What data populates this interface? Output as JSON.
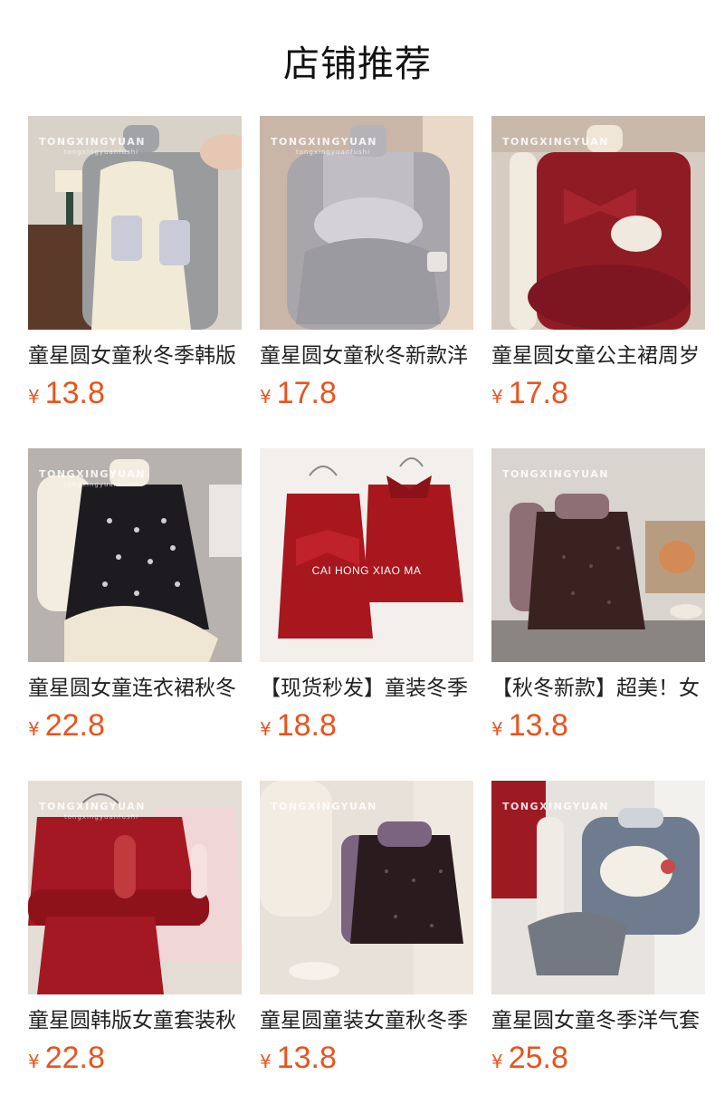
{
  "page": {
    "title": "店铺推荐"
  },
  "products": [
    {
      "name": "童星圆女童秋冬季韩版",
      "currency": "¥",
      "price": "13.8",
      "watermark": "TONGXINGYUAN",
      "watermark_sub": "tongxingyuanfushi"
    },
    {
      "name": "童星圆女童秋冬新款洋",
      "currency": "¥",
      "price": "17.8",
      "watermark": "TONGXINGYUAN",
      "watermark_sub": "tongxingyuanfushi"
    },
    {
      "name": "童星圆女童公主裙周岁",
      "currency": "¥",
      "price": "17.8",
      "watermark": "TONGXINGYUAN",
      "watermark_sub": ""
    },
    {
      "name": "童星圆女童连衣裙秋冬",
      "currency": "¥",
      "price": "22.8",
      "watermark": "TONGXINGYUAN",
      "watermark_sub": "tongxingyuanfushi"
    },
    {
      "name": "【现货秒发】童装冬季",
      "currency": "¥",
      "price": "18.8",
      "watermark": "",
      "watermark_sub": "",
      "overlay": "CAI HONG XIAO MA"
    },
    {
      "name": "【秋冬新款】超美！女",
      "currency": "¥",
      "price": "13.8",
      "watermark": "TONGXINGYUAN",
      "watermark_sub": ""
    },
    {
      "name": "童星圆韩版女童套装秋",
      "currency": "¥",
      "price": "22.8",
      "watermark": "TONGXINGYUAN",
      "watermark_sub": "tongxingyuanfushi"
    },
    {
      "name": "童星圆童装女童秋冬季",
      "currency": "¥",
      "price": "13.8",
      "watermark": "TONGXINGYUAN",
      "watermark_sub": ""
    },
    {
      "name": "童星圆女童冬季洋气套",
      "currency": "¥",
      "price": "25.8",
      "watermark": "TONGXINGYUAN",
      "watermark_sub": ""
    }
  ]
}
